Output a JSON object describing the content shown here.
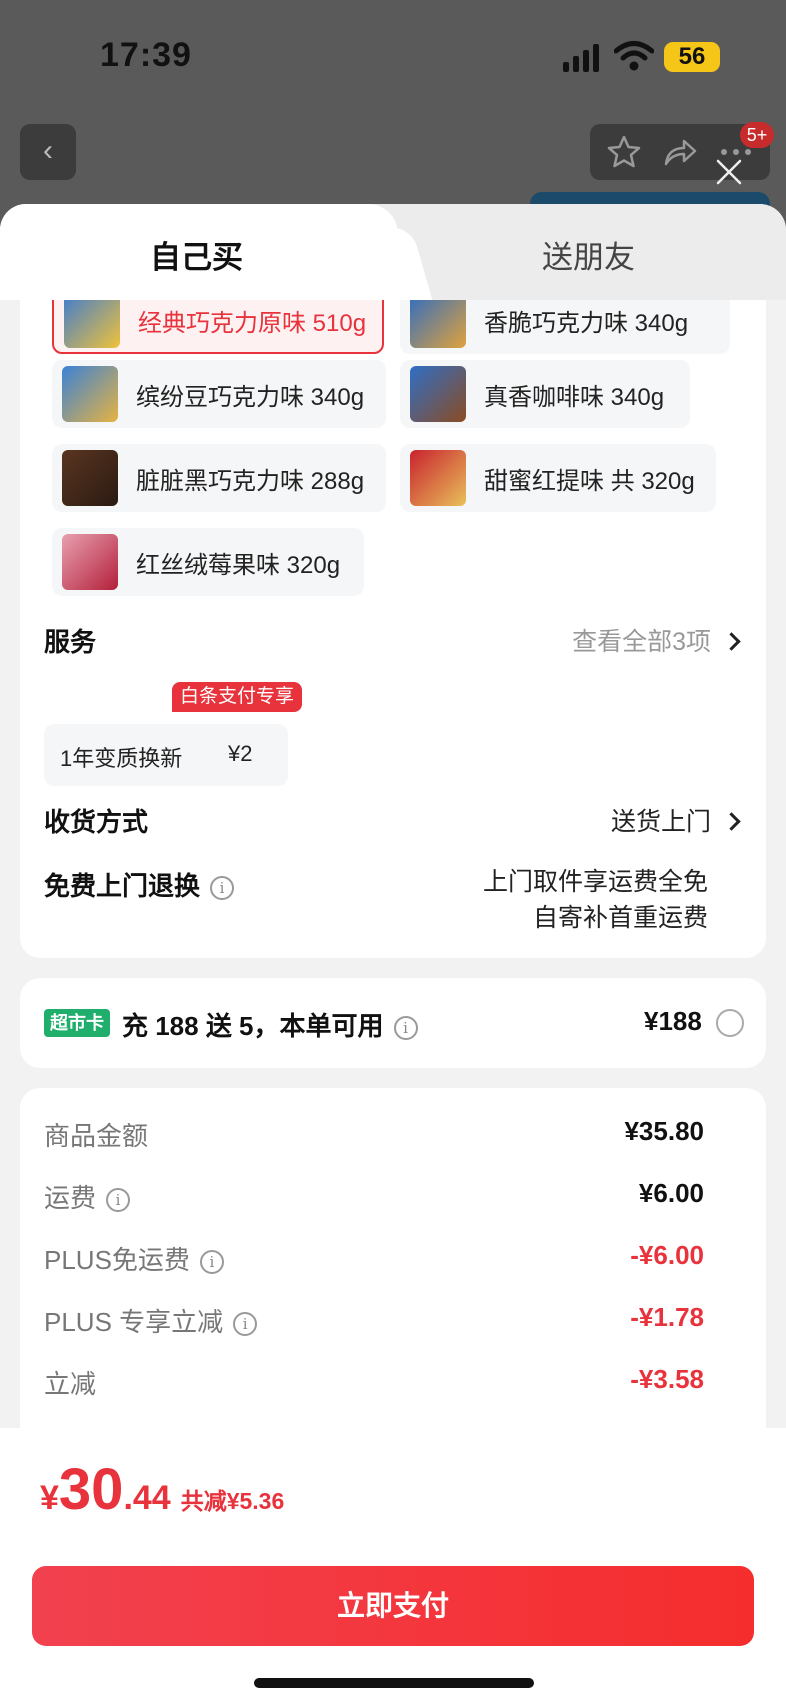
{
  "status_bar": {
    "time": "17:39",
    "battery": "56"
  },
  "background": {
    "notification_badge": "5+"
  },
  "tabs": [
    {
      "label": "自己买",
      "active": true
    },
    {
      "label": "送朋友",
      "active": false
    }
  ],
  "variants": [
    {
      "label": "经典巧克力原味 510g",
      "selected": true
    },
    {
      "label": "香脆巧克力味 340g",
      "selected": false
    },
    {
      "label": "缤纷豆巧克力味 340g",
      "selected": false
    },
    {
      "label": "真香咖啡味 340g",
      "selected": false
    },
    {
      "label": "脏脏黑巧克力味 288g",
      "selected": false
    },
    {
      "label": "甜蜜红提味 共 320g",
      "selected": false
    },
    {
      "label": "红丝绒莓果味 320g",
      "selected": false
    }
  ],
  "service": {
    "title": "服务",
    "view_all": "查看全部3项",
    "tag": "白条支付专享",
    "item_name": "1年变质换新",
    "item_price": "¥2"
  },
  "delivery": {
    "title": "收货方式",
    "value": "送货上门"
  },
  "free_return": {
    "title": "免费上门退换",
    "line1": "上门取件享运费全免",
    "line2": "自寄补首重运费"
  },
  "supermarket_card": {
    "badge": "超市卡",
    "text": "充 188 送 5，本单可用",
    "price": "¥188"
  },
  "fees": [
    {
      "label": "商品金额",
      "value": "¥35.80",
      "info": false,
      "discount": false
    },
    {
      "label": "运费",
      "value": "¥6.00",
      "info": true,
      "discount": false
    },
    {
      "label": "PLUS免运费",
      "value": "-¥6.00",
      "info": true,
      "discount": true
    },
    {
      "label": "PLUS 专享立减",
      "value": "-¥1.78",
      "info": true,
      "discount": true
    },
    {
      "label": "立减",
      "value": "-¥3.58",
      "info": false,
      "discount": true
    }
  ],
  "total": {
    "currency": "¥",
    "integer": "30",
    "decimal": ".44",
    "savings": "共减¥5.36"
  },
  "pay_button": "立即支付",
  "colors": {
    "accent": "#e8323c",
    "card_badge": "#1fae6b"
  }
}
